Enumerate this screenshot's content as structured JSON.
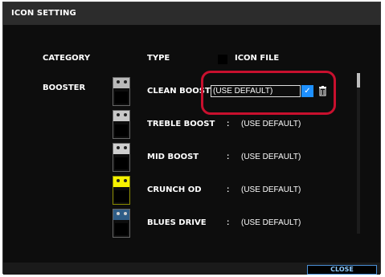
{
  "dialog": {
    "title": "ICON SETTING",
    "headers": {
      "category": "CATEGORY",
      "type": "TYPE",
      "icon_file": "ICON FILE"
    },
    "category": "BOOSTER",
    "rows": [
      {
        "type": "CLEAN BOOST",
        "value": "(USE DEFAULT)",
        "pedal_color": "#b9b9b9"
      },
      {
        "type": "TREBLE BOOST",
        "value": "(USE DEFAULT)",
        "pedal_color": "#c9c9c9"
      },
      {
        "type": "MID BOOST",
        "value": "(USE DEFAULT)",
        "pedal_color": "#cfcfcf"
      },
      {
        "type": "CRUNCH OD",
        "value": "(USE DEFAULT)",
        "pedal_color": "#f6f200"
      },
      {
        "type": "BLUES DRIVE",
        "value": "(USE DEFAULT)",
        "pedal_color": "#2f5d87"
      }
    ],
    "separator": ":",
    "selected_row_index": 0,
    "close_label": "CLOSE"
  },
  "colors": {
    "dialog_bg": "#0d0d0d",
    "titlebar_bg": "#2c2c2c",
    "accent_blue": "#1e90ff",
    "highlight_red": "#c8102e",
    "close_text": "#8ecbff"
  },
  "icons": {
    "confirm": "check-icon",
    "delete": "trash-icon"
  }
}
